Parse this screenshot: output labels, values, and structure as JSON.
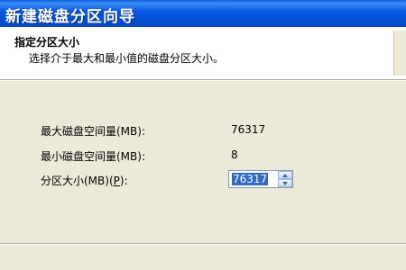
{
  "window": {
    "title": "新建磁盘分区向导"
  },
  "header": {
    "title": "指定分区大小",
    "subtitle": "选择介于最大和最小值的磁盘分区大小。"
  },
  "fields": {
    "max_label": "最大磁盘空间量(MB):",
    "max_value": "76317",
    "min_label": "最小磁盘空间量(MB):",
    "min_value": "8",
    "size_label_prefix": "分区大小(MB)(",
    "size_label_key": "P",
    "size_label_suffix": "):",
    "size_value": "76317"
  }
}
